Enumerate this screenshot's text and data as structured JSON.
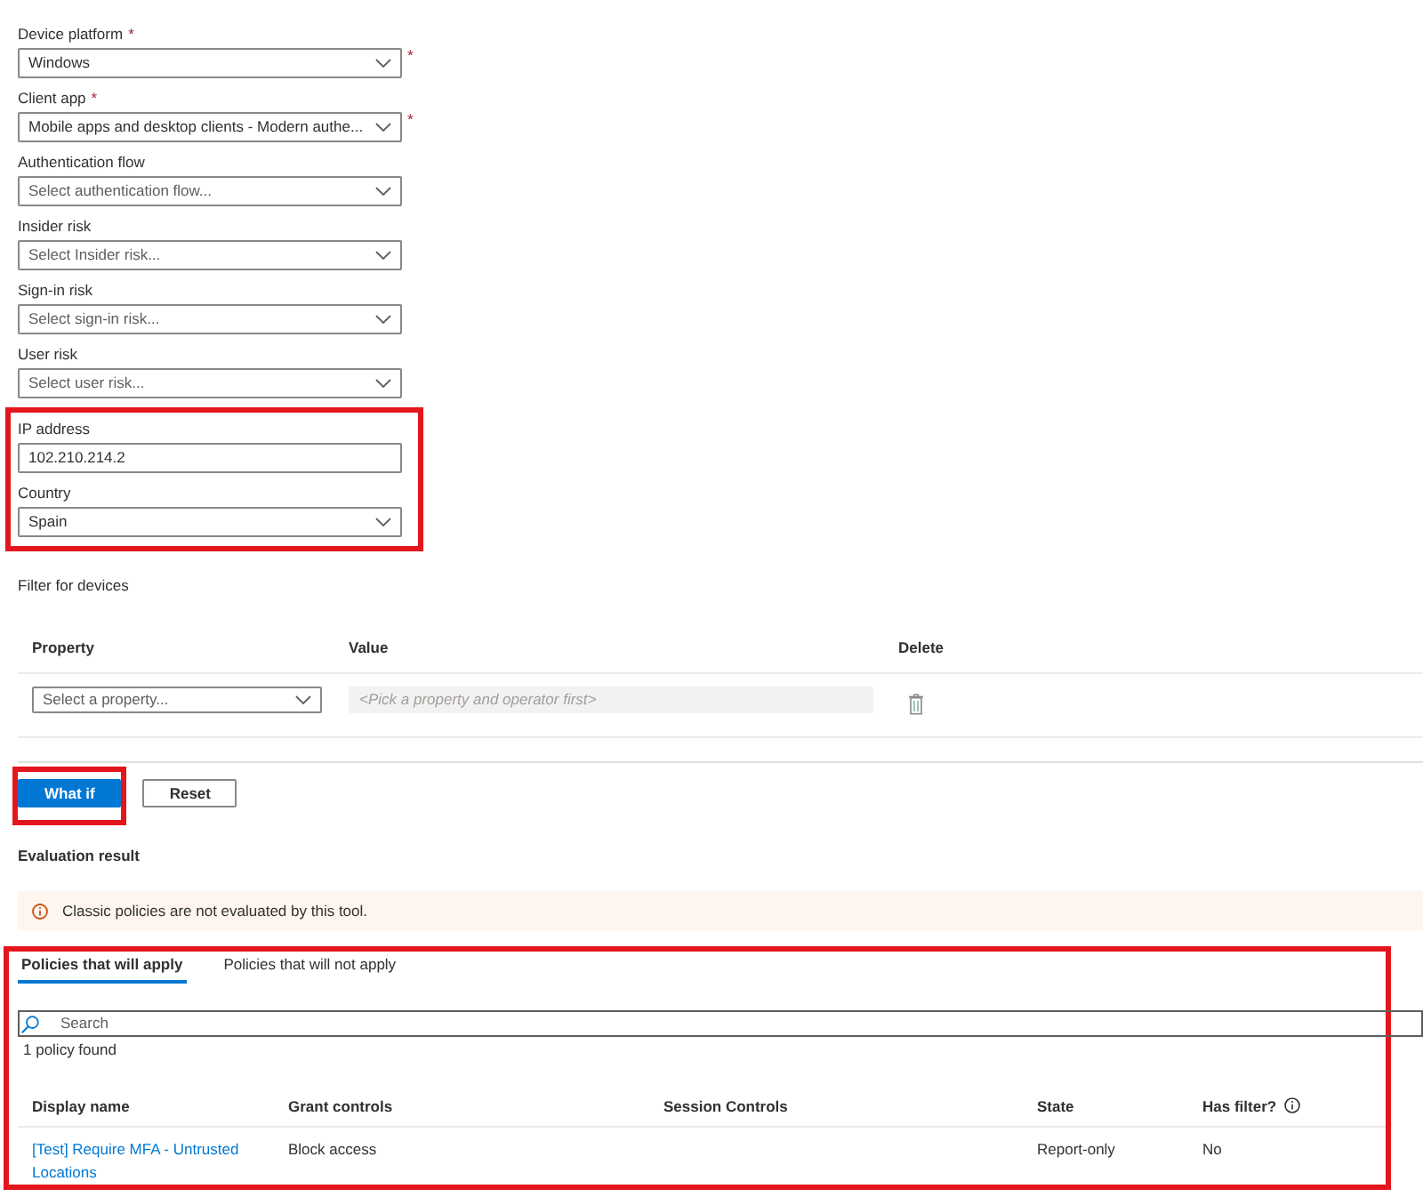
{
  "conditions": {
    "fields": [
      {
        "label": "Device platform",
        "label_mark": "*",
        "kind": "dropdown",
        "value": "Windows",
        "side_mark": "*"
      },
      {
        "label": "Client app",
        "label_mark": "*",
        "kind": "dropdown",
        "value": "Mobile apps and desktop clients - Modern authe...",
        "side_mark": "*"
      },
      {
        "label": "Authentication flow",
        "kind": "dropdown",
        "placeholder": "Select authentication flow..."
      },
      {
        "label": "Insider risk",
        "kind": "dropdown",
        "placeholder": "Select Insider risk..."
      },
      {
        "label": "Sign-in risk",
        "kind": "dropdown",
        "placeholder": "Select sign-in risk..."
      },
      {
        "label": "User risk",
        "kind": "dropdown",
        "placeholder": "Select user risk..."
      }
    ],
    "location": {
      "highlighted": true,
      "fields": [
        {
          "label": "IP address",
          "kind": "text",
          "value": "102.210.214.2"
        },
        {
          "label": "Country",
          "kind": "dropdown",
          "value": "Spain"
        }
      ]
    }
  },
  "device_filter": {
    "title": "Filter for devices",
    "columns": [
      "Property",
      "Value",
      "Delete"
    ],
    "rows": [
      {
        "property": {
          "kind": "dropdown",
          "placeholder": "Select a property...",
          "disabled": false
        },
        "value": {
          "kind": "text",
          "placeholder": "<Pick a property and operator first>",
          "disabled": true
        }
      }
    ]
  },
  "actions": [
    {
      "label": "What if",
      "kind": "primary",
      "highlighted": true
    },
    {
      "label": "Reset",
      "kind": "secondary",
      "highlighted": false
    }
  ],
  "evaluation": {
    "title": "Evaluation result",
    "notice": "Classic policies are not evaluated by this tool."
  },
  "results": {
    "highlighted": true,
    "tabs": [
      {
        "label": "Policies that will apply",
        "selected": true
      },
      {
        "label": "Policies that will not apply",
        "selected": false
      }
    ],
    "search": {
      "placeholder": "Search"
    },
    "count": "1 policy found",
    "table": {
      "columns": [
        {
          "label": "Display name",
          "info": false
        },
        {
          "label": "Grant controls",
          "info": false
        },
        {
          "label": "Session Controls",
          "info": false
        },
        {
          "label": "State",
          "info": false
        },
        {
          "label": "Has filter?",
          "info": true
        }
      ],
      "rows": [
        {
          "display_name": "[Test] Require MFA - Untrusted Locations",
          "grant_controls": "Block access",
          "state": "Report-only",
          "has_filter": "No"
        }
      ]
    }
  }
}
